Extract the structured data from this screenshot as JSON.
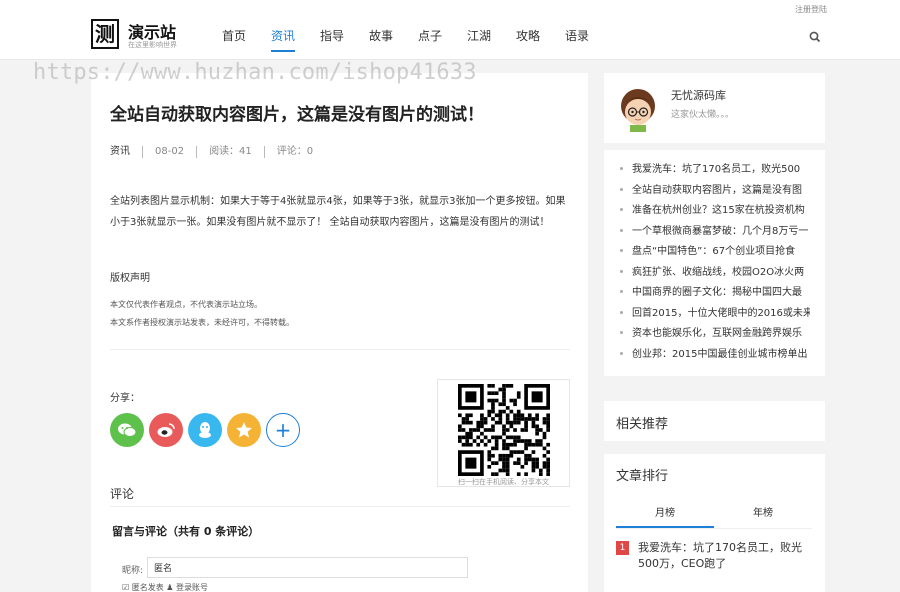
{
  "header": {
    "login_link": "注册登陆",
    "logo_mark": "测",
    "logo_name": "演示站",
    "logo_slogan": "在这里影响世界",
    "nav": [
      "首页",
      "资讯",
      "指导",
      "故事",
      "点子",
      "江湖",
      "攻略",
      "语录"
    ],
    "active_nav": "资讯"
  },
  "watermark": "https://www.huzhan.com/ishop41633",
  "article": {
    "title": "全站自动获取内容图片，这篇是没有图片的测试！",
    "category": "资讯",
    "date": "08-02",
    "views": "阅读：41",
    "comments": "评论：0",
    "body": "全站列表图片显示机制：如果大于等于4张就显示4张，如果等于3张，就显示3张加一个更多按钮。如果小于3张就显示一张。如果没有图片就不显示了！ 全站自动获取内容图片，这篇是没有图片的测试！",
    "copyright_title": "版权声明",
    "copyright_lines": [
      "本文仅代表作者观点，不代表演示站立场。",
      "本文系作者授权演示站发表，未经许可，不得转载。"
    ],
    "share_label": "分享：",
    "share_icons": [
      "wechat-icon",
      "weibo-icon",
      "qq-icon",
      "qzone-icon",
      "plus-icon"
    ],
    "qr_caption": "扫一扫在手机阅读、分享本文",
    "comment_heading": "评论",
    "comment_sub": "留言与评论（共有 0 条评论）",
    "nick_label": "昵称:",
    "nick_value": "匿名",
    "anon_text": "匿名发表 ♟ 登录账号"
  },
  "sidebar": {
    "author_name": "无忧源码库",
    "author_bio": "这家伙太懒。。。",
    "latest": [
      "我爱洗车：坑了170名员工，败光500",
      "全站自动获取内容图片，这篇是没有图",
      "准备在杭州创业？这15家在杭投资机构",
      "一个草根微商暴富梦破：几个月8万亏一",
      "盘点“中国特色”：67个创业项目抢食",
      "疯狂扩张、收缩战线，校园O2O冰火两",
      "中国商界的圈子文化：揭秘中国四大最",
      "回首2015，十位大佬眼中的2016或未来",
      "资本也能娱乐化，互联网金融跨界娱乐",
      "创业邦：2015中国最佳创业城市榜单出"
    ],
    "related_title": "相关推荐",
    "ranking_title": "文章排行",
    "ranking_tabs": [
      "月榜",
      "年榜"
    ],
    "ranking_top": {
      "num": "1",
      "text": "我爱洗车：坑了170名员工，败光500万，CEO跑了"
    }
  },
  "colors": {
    "accent": "#1e7fd6",
    "rank": "#e04848",
    "wechat": "#5ec14c",
    "weibo": "#e95a5a",
    "qq": "#39b8f0",
    "qzone": "#f5b335"
  }
}
